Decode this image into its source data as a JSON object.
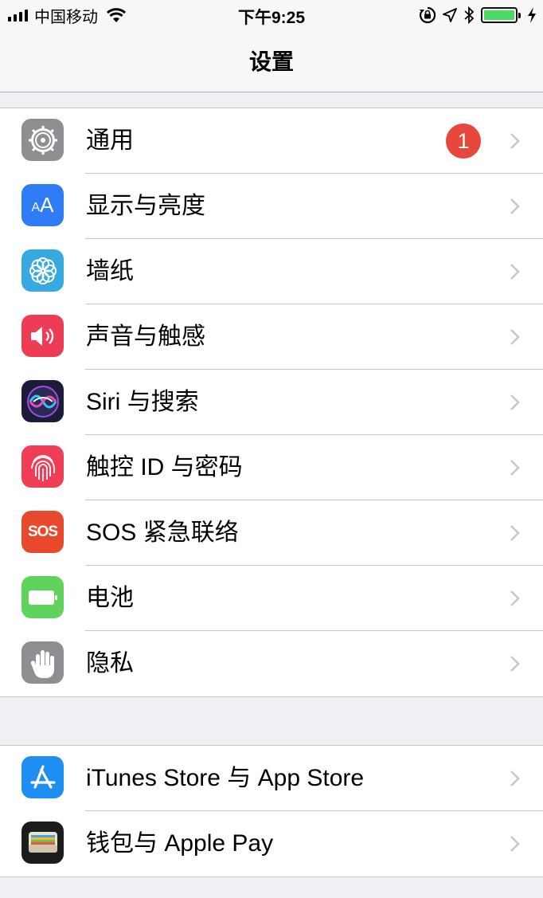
{
  "status_bar": {
    "carrier": "中国移动",
    "time": "下午9:25"
  },
  "nav": {
    "title": "设置"
  },
  "groups": [
    {
      "items": [
        {
          "label": "通用",
          "icon": "gear-icon",
          "color": "#8e8e93",
          "badge": "1"
        },
        {
          "label": "显示与亮度",
          "icon": "text-size-icon",
          "color": "#2f7cf6"
        },
        {
          "label": "墙纸",
          "icon": "flower-icon",
          "color": "#36a9e0"
        },
        {
          "label": "声音与触感",
          "icon": "speaker-icon",
          "color": "#ee3c55"
        },
        {
          "label": "Siri 与搜索",
          "icon": "siri-icon",
          "color": "#1b1b3a"
        },
        {
          "label": "触控 ID 与密码",
          "icon": "fingerprint-icon",
          "color": "#ef3e56"
        },
        {
          "label": "SOS 紧急联络",
          "icon": "sos-icon",
          "color": "#e8492c",
          "icon_text": "SOS"
        },
        {
          "label": "电池",
          "icon": "battery-icon",
          "color": "#5fd35b"
        },
        {
          "label": "隐私",
          "icon": "hand-icon",
          "color": "#8e8e93"
        }
      ]
    },
    {
      "items": [
        {
          "label": "iTunes Store 与 App Store",
          "icon": "app-store-icon",
          "color": "#1e8ef3"
        },
        {
          "label": "钱包与 Apple Pay",
          "icon": "wallet-icon",
          "color": "#1c1c1c"
        }
      ]
    }
  ]
}
